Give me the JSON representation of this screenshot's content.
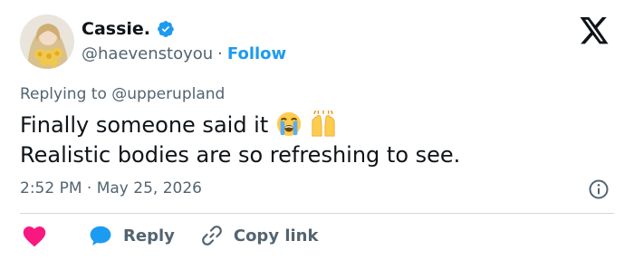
{
  "author": {
    "name": "Cassie.",
    "handle": "@haevenstoyou",
    "separator": "·",
    "follow_label": "Follow"
  },
  "reply_context": {
    "prefix": "Replying to",
    "mention": "@upperupland"
  },
  "tweet": {
    "line1": "Finally someone said it",
    "line1_emojis": [
      "loudly-crying-face",
      "raising-hands"
    ],
    "line2": "Realistic bodies are so refreshing to see."
  },
  "meta": {
    "time": "2:52 PM",
    "separator": "·",
    "date": "May 25, 2026"
  },
  "actions": {
    "reply_label": "Reply",
    "copy_link_label": "Copy link"
  },
  "colors": {
    "accent": "#1d9bf0",
    "like": "#f91880",
    "text": "#0f1419",
    "secondary": "#536471",
    "divider": "#cfd9de"
  }
}
